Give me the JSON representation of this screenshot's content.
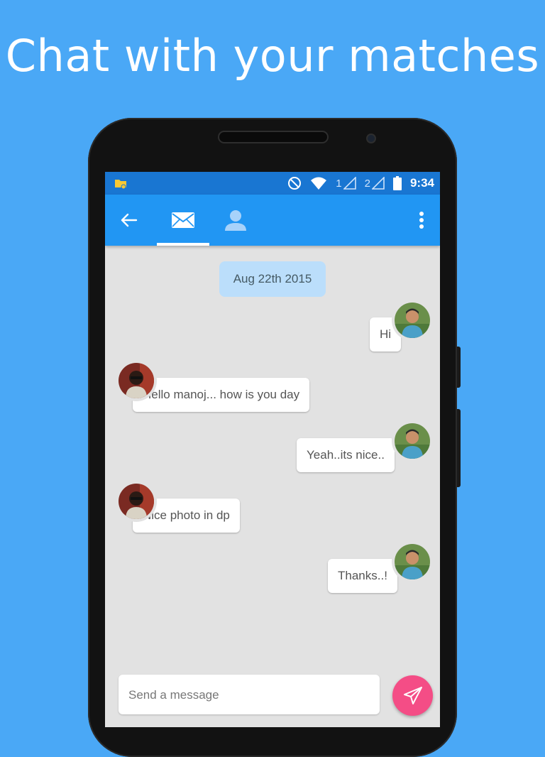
{
  "headline": "Chat with your matches",
  "status_bar": {
    "sim1": "1",
    "sim2": "2",
    "time": "9:34"
  },
  "app_bar": {
    "back_icon": "arrow-left-icon",
    "tabs": [
      {
        "icon": "envelope-icon",
        "active": true
      },
      {
        "icon": "person-icon",
        "active": false
      }
    ],
    "menu_icon": "more-vert-icon"
  },
  "conversation": {
    "date": "Aug 22th 2015",
    "messages": [
      {
        "text": "Hi",
        "side": "right"
      },
      {
        "text": "Hello manoj... how is you day",
        "side": "left"
      },
      {
        "text": "Yeah..its nice..",
        "side": "right"
      },
      {
        "text": "Nice photo in dp",
        "side": "left"
      },
      {
        "text": "Thanks..!",
        "side": "right"
      }
    ]
  },
  "composer": {
    "placeholder": "Send a message",
    "send_icon": "paper-plane-icon"
  },
  "colors": {
    "background": "#4aa8f6",
    "status_bar": "#1976d2",
    "app_bar": "#2196f3",
    "date_chip": "#bbdefb",
    "send_button": "#f44d86",
    "chat_background": "#e2e2e2"
  }
}
